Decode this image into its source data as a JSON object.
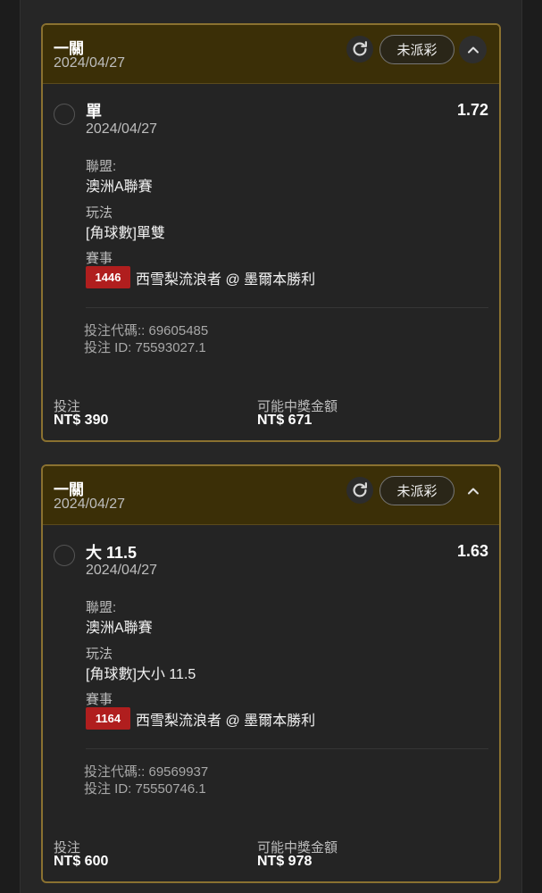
{
  "bets": [
    {
      "bet_type": "一關",
      "date": "2024/04/27",
      "status": "未派彩",
      "selection": "單",
      "odds": "1.72",
      "selection_date": "2024/04/27",
      "league_label": "聯盟:",
      "league": "澳洲A聯賽",
      "market_label": "玩法",
      "market": "[角球數]單雙",
      "event_label": "賽事",
      "event_id": "1446",
      "event_name": "西雪梨流浪者 @ 墨爾本勝利",
      "bet_code": "投注代碼:: 69605485",
      "bet_id": "投注 ID: 75593027.1",
      "stake_label": "投注",
      "stake": "NT$ 390",
      "payout_label": "可能中獎金額",
      "payout": "NT$ 671"
    },
    {
      "bet_type": "一關",
      "date": "2024/04/27",
      "status": "未派彩",
      "selection": "大 11.5",
      "odds": "1.63",
      "selection_date": "2024/04/27",
      "league_label": "聯盟:",
      "league": "澳洲A聯賽",
      "market_label": "玩法",
      "market": "[角球數]大小 11.5",
      "event_label": "賽事",
      "event_id": "1164",
      "event_name": "西雪梨流浪者 @ 墨爾本勝利",
      "bet_code": "投注代碼:: 69569937",
      "bet_id": "投注 ID: 75550746.1",
      "stake_label": "投注",
      "stake": "NT$ 600",
      "payout_label": "可能中獎金額",
      "payout": "NT$ 978"
    }
  ],
  "icons": {
    "refresh": "refresh-icon",
    "collapse": "chevron-up-icon",
    "radio": "radio-circle"
  },
  "colors": {
    "accent_border": "#8a7130",
    "header_bg": "#3b2f07",
    "event_badge": "#b01e1e"
  }
}
